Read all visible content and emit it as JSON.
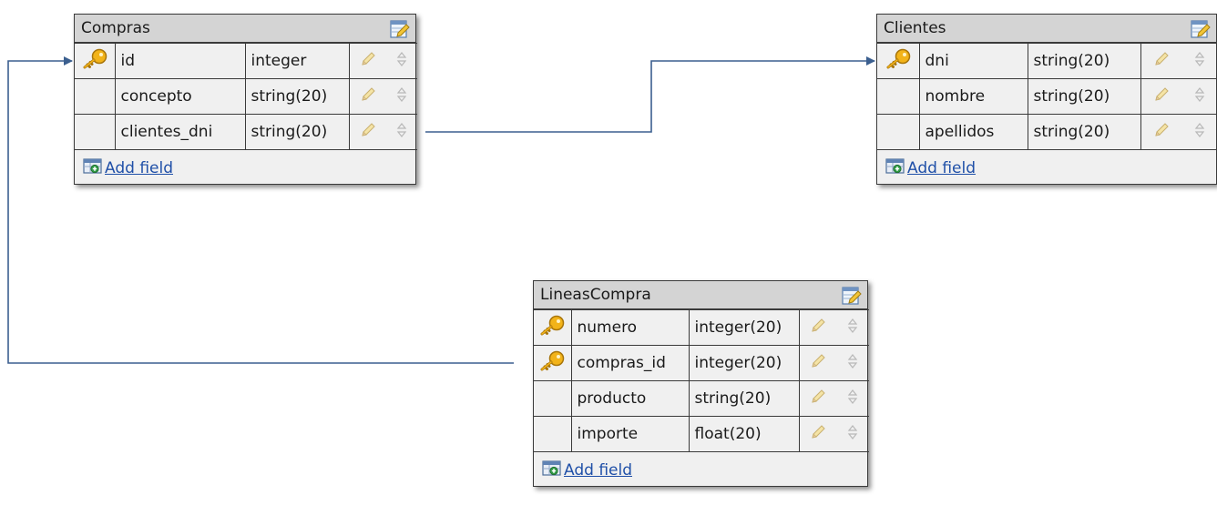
{
  "tables": [
    {
      "id": "compras",
      "name": "Compras",
      "fields": [
        {
          "name": "id",
          "type": "integer",
          "key": true
        },
        {
          "name": "concepto",
          "type": "string(20)",
          "key": false
        },
        {
          "name": "clientes_dni",
          "type": "string(20)",
          "key": false
        }
      ],
      "add_field_label": "Add field"
    },
    {
      "id": "clientes",
      "name": "Clientes",
      "fields": [
        {
          "name": "dni",
          "type": "string(20)",
          "key": true
        },
        {
          "name": "nombre",
          "type": "string(20)",
          "key": false
        },
        {
          "name": "apellidos",
          "type": "string(20)",
          "key": false
        }
      ],
      "add_field_label": "Add field"
    },
    {
      "id": "lineascompra",
      "name": "LineasCompra",
      "fields": [
        {
          "name": "numero",
          "type": "integer(20)",
          "key": true
        },
        {
          "name": "compras_id",
          "type": "integer(20)",
          "key": true
        },
        {
          "name": "producto",
          "type": "string(20)",
          "key": false
        },
        {
          "name": "importe",
          "type": "float(20)",
          "key": false
        }
      ],
      "add_field_label": "Add field"
    }
  ],
  "relations": [
    {
      "from": "compras.clientes_dni",
      "to": "clientes.dni"
    },
    {
      "from": "lineascompra.compras_id",
      "to": "compras.id"
    }
  ],
  "colors": {
    "connector": "#3b5f8f",
    "link": "#2050a8",
    "header_bg": "#d4d4d4",
    "body_bg": "#f0f0f0"
  }
}
